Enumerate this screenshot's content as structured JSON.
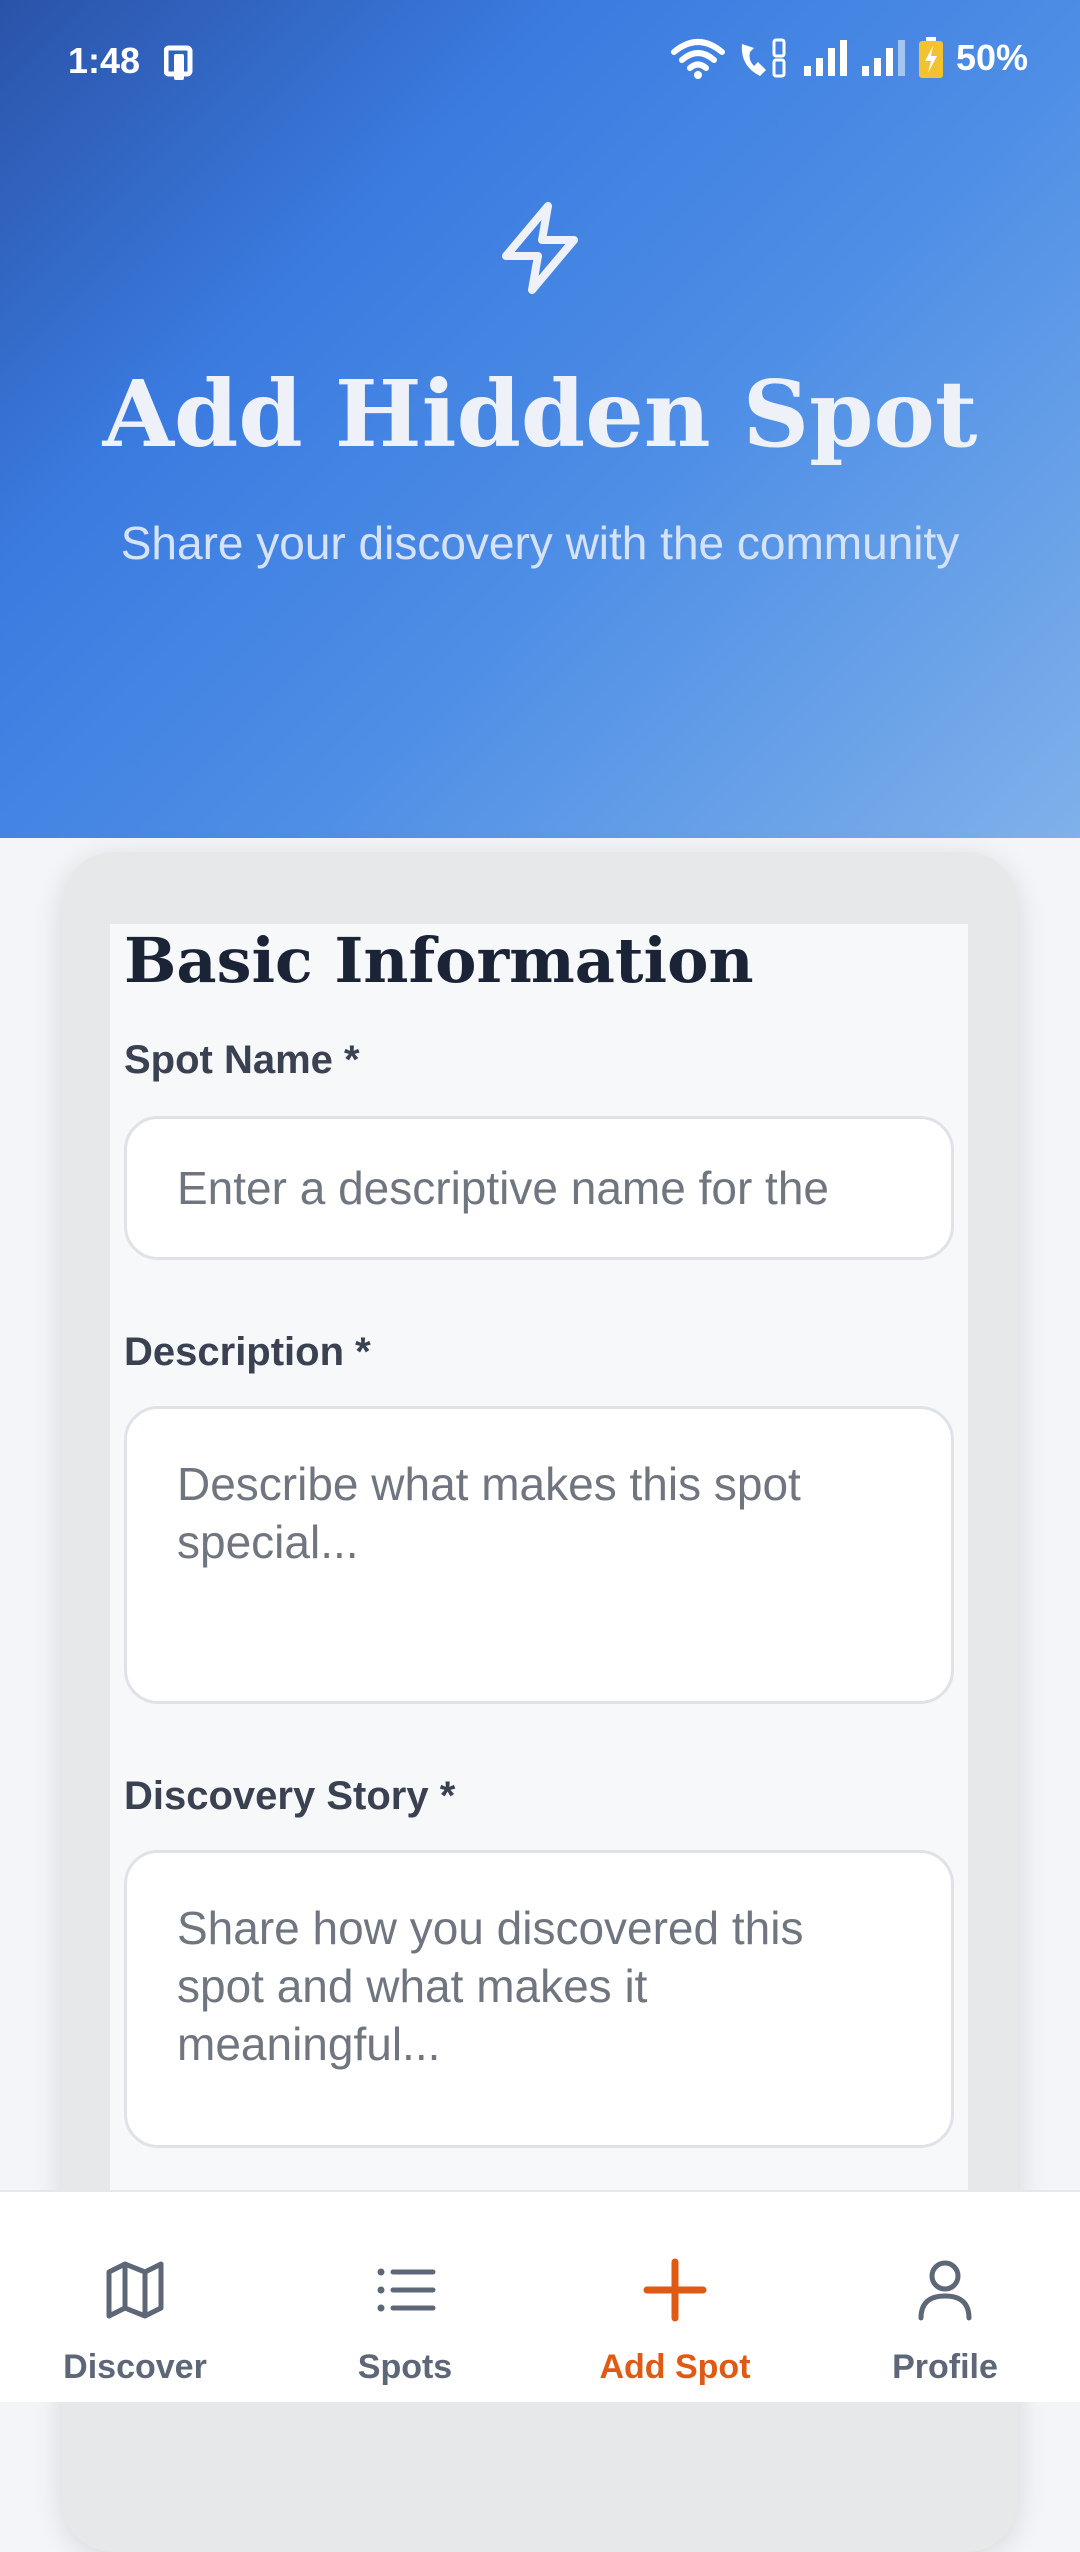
{
  "status_bar": {
    "time": "1:48",
    "battery": "50%",
    "icons": [
      "device-icon",
      "wifi-icon",
      "wifi-call-icon",
      "signal-icon",
      "signal-icon",
      "battery-charging-icon"
    ]
  },
  "header": {
    "icon": "lightning-icon",
    "title": "Add Hidden Spot",
    "subtitle": "Share your discovery with the community"
  },
  "form": {
    "section_title": "Basic Information",
    "spot_name": {
      "label": "Spot Name *",
      "placeholder": "Enter a descriptive name for the"
    },
    "description": {
      "label": "Description *",
      "placeholder": "Describe what makes this spot special..."
    },
    "discovery_story": {
      "label": "Discovery Story *",
      "placeholder": "Share how you discovered this spot and what makes it meaningful..."
    }
  },
  "bottom_nav": {
    "items": [
      {
        "label": "Discover",
        "icon": "map-icon"
      },
      {
        "label": "Spots",
        "icon": "list-icon"
      },
      {
        "label": "Add Spot",
        "icon": "plus-icon"
      },
      {
        "label": "Profile",
        "icon": "user-icon"
      }
    ],
    "active": "Add Spot"
  },
  "colors": {
    "accent": "#e05a13",
    "hero_gradient_start": "#2a53a8",
    "hero_gradient_end": "#7fb1ea",
    "nav_inactive": "#5d6778"
  }
}
